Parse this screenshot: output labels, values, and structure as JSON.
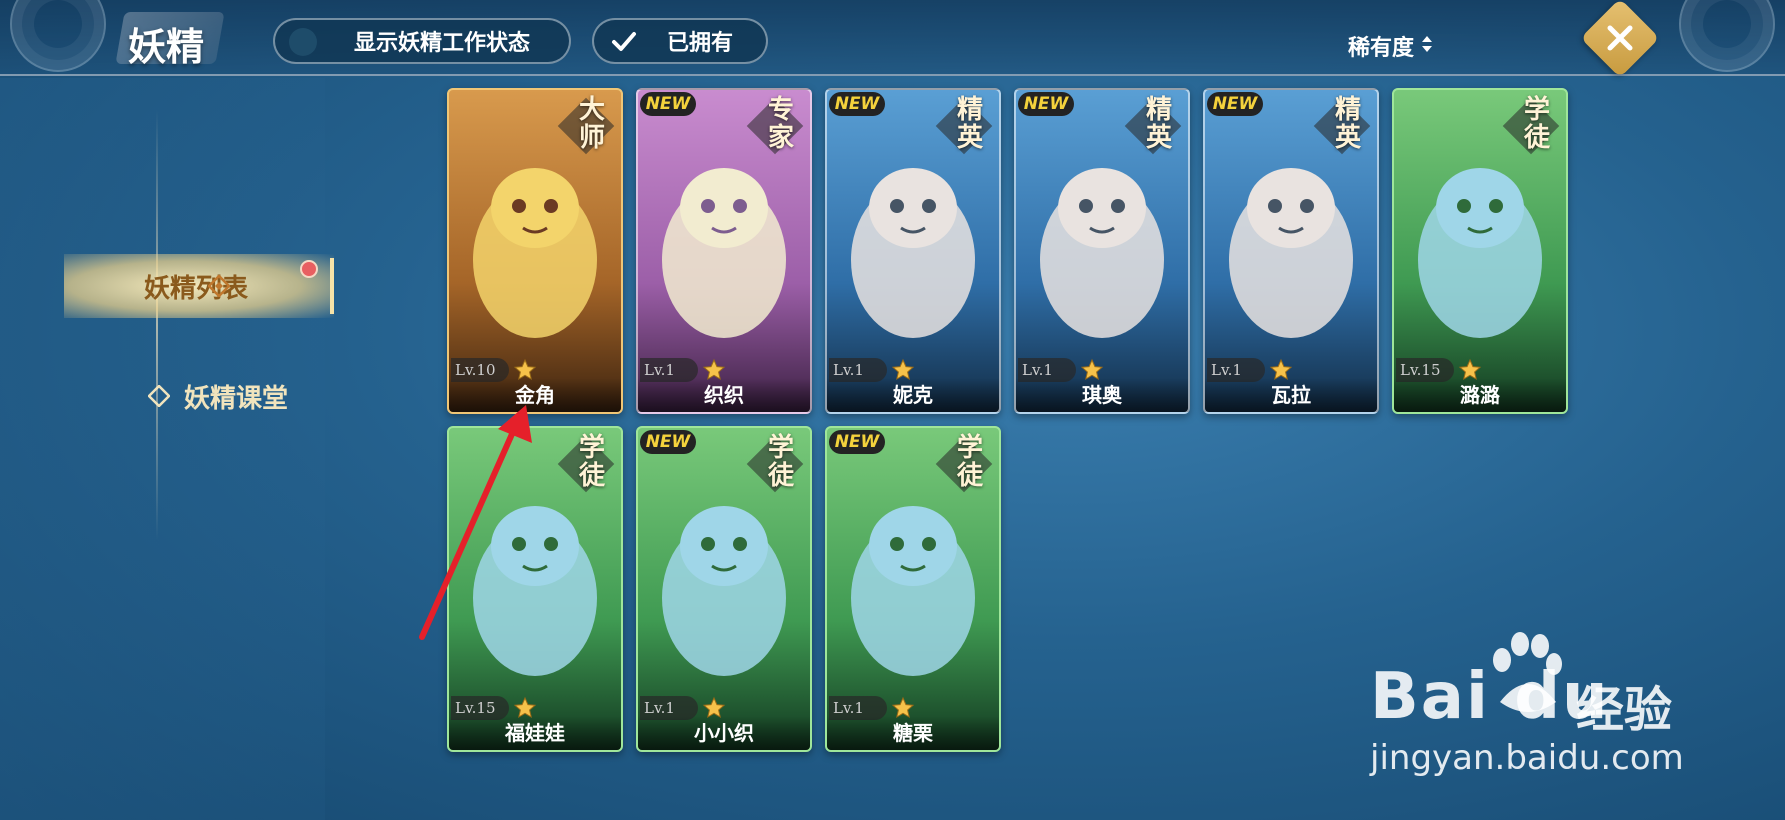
{
  "header": {
    "title": "妖精",
    "show_status_label": "显示妖精工作状态",
    "owned_label": "已拥有",
    "sort_label": "稀有度"
  },
  "sidebar": {
    "items": [
      {
        "label": "妖精列表",
        "active": true,
        "has_notification": true
      },
      {
        "label": "妖精课堂",
        "active": false
      }
    ]
  },
  "cards": [
    {
      "name": "金角",
      "rank": "大师",
      "level": "Lv.10",
      "is_new": false,
      "theme": "gold"
    },
    {
      "name": "织织",
      "rank": "专家",
      "level": "Lv.1",
      "is_new": true,
      "theme": "purple"
    },
    {
      "name": "妮克",
      "rank": "精英",
      "level": "Lv.1",
      "is_new": true,
      "theme": "blue"
    },
    {
      "name": "琪奥",
      "rank": "精英",
      "level": "Lv.1",
      "is_new": true,
      "theme": "blue"
    },
    {
      "name": "瓦拉",
      "rank": "精英",
      "level": "Lv.1",
      "is_new": true,
      "theme": "blue"
    },
    {
      "name": "潞潞",
      "rank": "学徒",
      "level": "Lv.15",
      "is_new": false,
      "theme": "green"
    },
    {
      "name": "福娃娃",
      "rank": "学徒",
      "level": "Lv.15",
      "is_new": false,
      "theme": "green"
    },
    {
      "name": "小小织",
      "rank": "学徒",
      "level": "Lv.1",
      "is_new": true,
      "theme": "green"
    },
    {
      "name": "糖栗",
      "rank": "学徒",
      "level": "Lv.1",
      "is_new": true,
      "theme": "green"
    }
  ],
  "new_tag_label": "NEW",
  "watermark": {
    "brand": "Bai du",
    "cn": "经验",
    "url": "jingyan.baidu.com"
  },
  "colors": {
    "accent_gold": "#e6c172",
    "notification": "#e85f61",
    "annotation_arrow": "#e5202a"
  }
}
